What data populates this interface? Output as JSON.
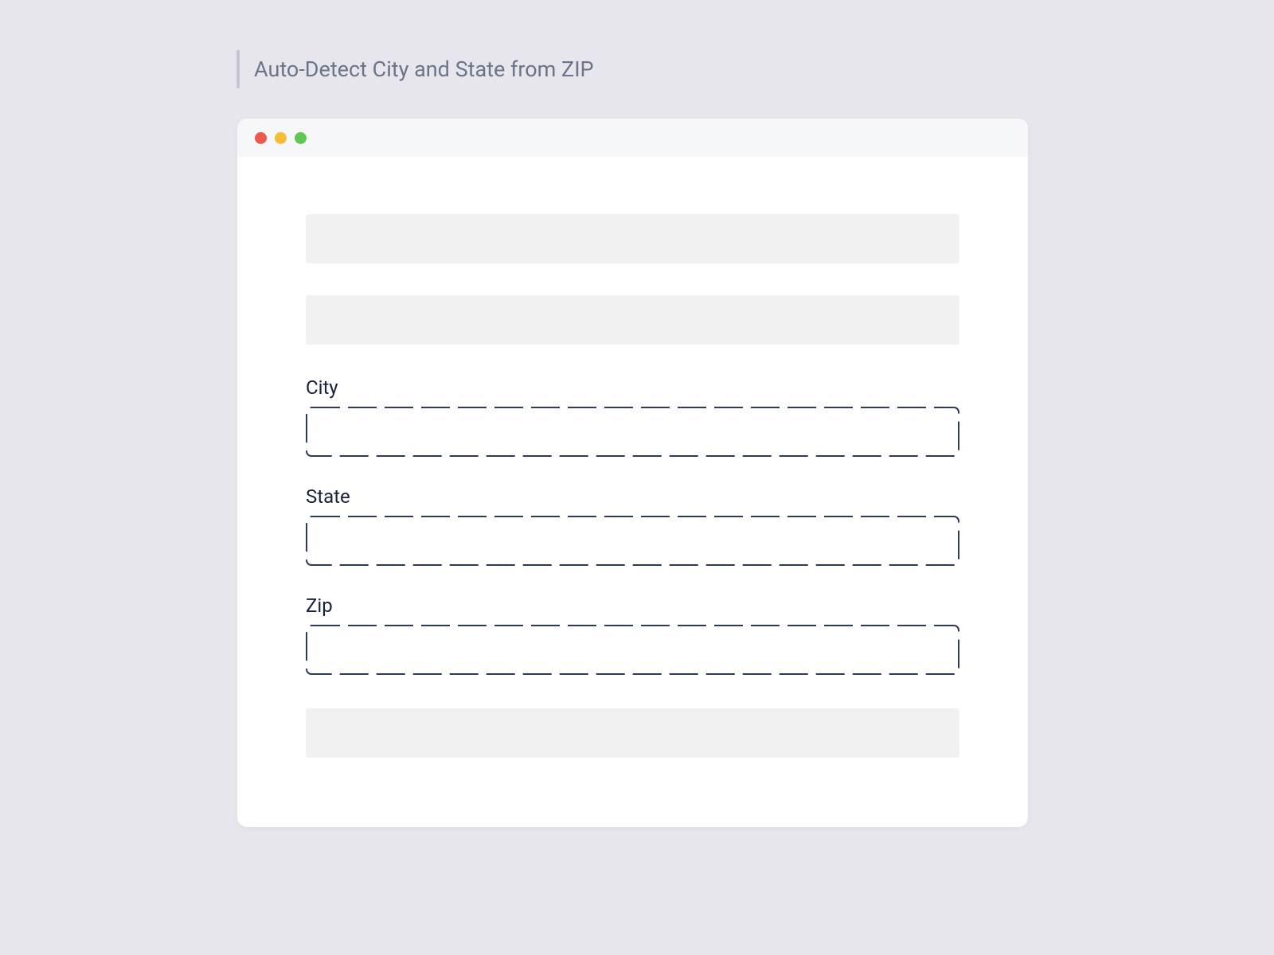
{
  "page": {
    "title": "Auto-Detect City and State from ZIP"
  },
  "form": {
    "city": {
      "label": "City",
      "value": ""
    },
    "state": {
      "label": "State",
      "value": ""
    },
    "zip": {
      "label": "Zip",
      "value": ""
    }
  }
}
